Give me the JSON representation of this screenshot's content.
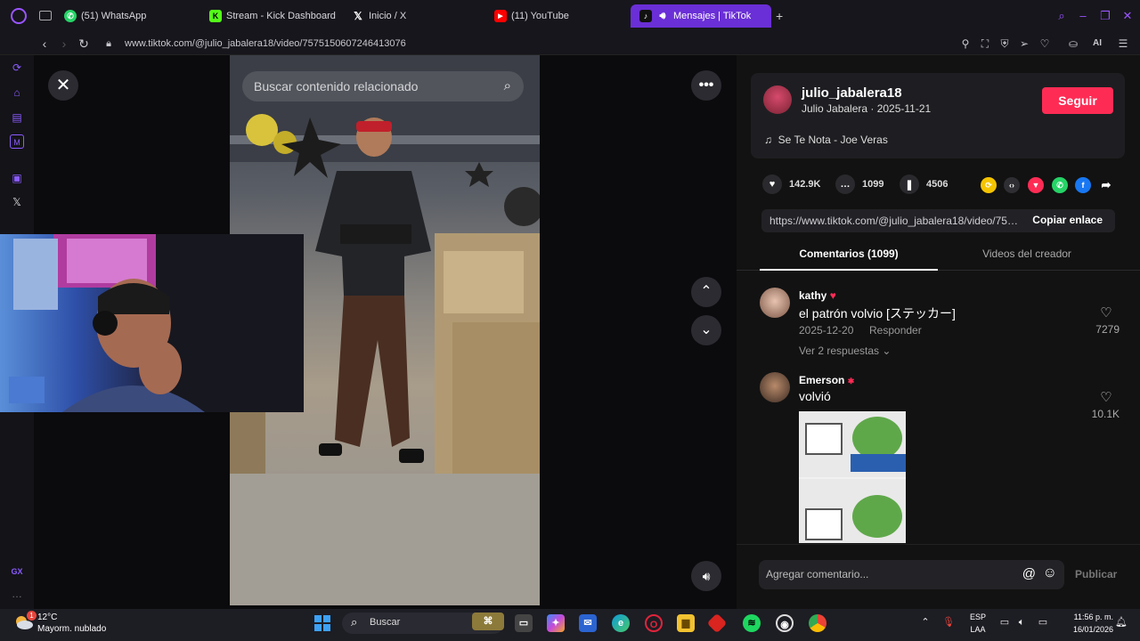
{
  "browser": {
    "tabs": [
      {
        "label": "(51) WhatsApp",
        "icon": "whatsapp-icon",
        "color": "#25d366"
      },
      {
        "label": "Stream - Kick Dashboard",
        "icon": "kick-icon",
        "color": "#53fc18"
      },
      {
        "label": "Inicio / X",
        "icon": "x-icon",
        "color": "#ffffff"
      },
      {
        "label": "(11) YouTube",
        "icon": "youtube-icon",
        "color": "#ff0000"
      },
      {
        "label": "Mensajes | TikTok",
        "icon": "tiktok-icon",
        "color": "#ffffff",
        "active": true
      }
    ],
    "url": "www.tiktok.com/@julio_jabalera18/video/7575150607246413076",
    "accent": "#6a2fd6",
    "ai_label": "AI"
  },
  "video": {
    "search_placeholder": "Buscar contenido relacionado"
  },
  "creator": {
    "username": "julio_jabalera18",
    "subline": "Julio Jabalera · 2025-11-21",
    "follow_label": "Seguir",
    "music": "Se Te Nota - Joe Veras"
  },
  "stats": {
    "likes": "142.9K",
    "comments": "1099",
    "saves": "4506"
  },
  "link": {
    "url": "https://www.tiktok.com/@julio_jabalera18/video/7575150607246413076",
    "copy_label": "Copiar enlace"
  },
  "panel_tabs": [
    {
      "label": "Comentarios (1099)",
      "active": true
    },
    {
      "label": "Videos del creador",
      "active": false
    }
  ],
  "comments": [
    {
      "name": "kathy",
      "text": "el patrón volvio [ステッカー]",
      "date": "2025-12-20",
      "reply_label": "Responder",
      "replies_label": "Ver 2 respuestas",
      "likes": "7279"
    },
    {
      "name": "Emerson",
      "text": "volvió",
      "likes": "10.1K"
    }
  ],
  "comment_input": {
    "placeholder": "Agregar comentario...",
    "publish_label": "Publicar"
  },
  "sidebar_extra": "GX",
  "taskbar": {
    "weather_temp": "12°C",
    "weather_desc": "Mayorm. nublado",
    "weather_badge": "1",
    "search_label": "Buscar",
    "lang_top": "ESP",
    "lang_bottom": "LAA",
    "time": "11:56 p. m.",
    "date": "16/01/2026"
  }
}
